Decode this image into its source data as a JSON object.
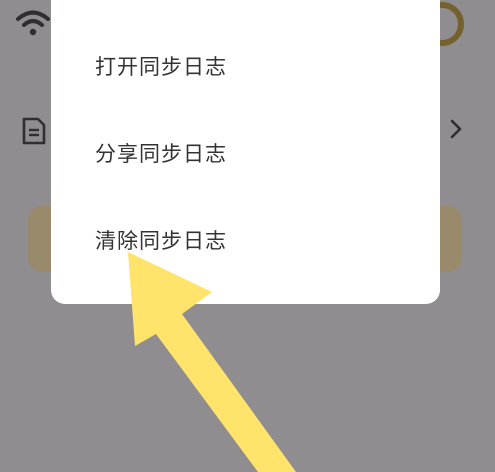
{
  "menu": {
    "items": [
      {
        "label": "打开同步日志"
      },
      {
        "label": "分享同步日志"
      },
      {
        "label": "清除同步日志"
      }
    ]
  },
  "colors": {
    "scrim": "#8f8d90",
    "menu_bg": "#ffffff",
    "menu_text": "#333333",
    "arrow": "#ffe36a",
    "accent_ring": "#74612e",
    "button_bg": "#988a6b"
  },
  "icons": [
    "wifi-icon",
    "document-icon",
    "chevron-right-icon",
    "arrow-annotation"
  ]
}
